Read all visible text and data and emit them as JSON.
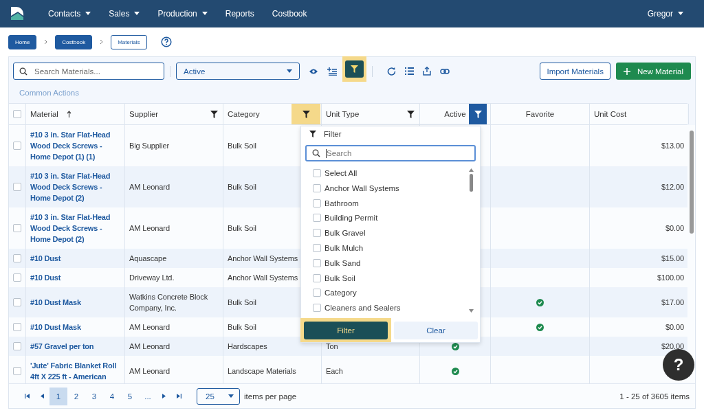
{
  "nav": {
    "items": [
      {
        "label": "Contacts",
        "has_menu": true
      },
      {
        "label": "Sales",
        "has_menu": true
      },
      {
        "label": "Production",
        "has_menu": true
      },
      {
        "label": "Reports",
        "has_menu": false
      },
      {
        "label": "Costbook",
        "has_menu": false
      }
    ],
    "user": {
      "label": "Gregor",
      "has_menu": true
    }
  },
  "breadcrumb": [
    {
      "label": "Home",
      "current": false
    },
    {
      "label": "Costbook",
      "current": false
    },
    {
      "label": "Materials",
      "current": true
    }
  ],
  "toolbar": {
    "search": {
      "placeholder": "Search Materials..."
    },
    "status_select": {
      "value": "Active"
    },
    "filter_toggle": {
      "selected": true,
      "highlighted": true
    },
    "import_button": "Import Materials",
    "new_button": "New Material"
  },
  "common_actions": "Common Actions",
  "table": {
    "all_selected": false,
    "columns": [
      {
        "label": "Material",
        "kind": "link",
        "sorted": true,
        "filterable": false,
        "filter_active": false,
        "highlighted": false
      },
      {
        "label": "Supplier",
        "kind": "text",
        "sorted": false,
        "filterable": true,
        "filter_active": false,
        "highlighted": false
      },
      {
        "label": "Category",
        "kind": "text",
        "sorted": false,
        "filterable": true,
        "filter_active": false,
        "highlighted": true
      },
      {
        "label": "Unit Type",
        "kind": "text",
        "sorted": false,
        "filterable": true,
        "filter_active": false,
        "highlighted": false
      },
      {
        "label": "Active",
        "kind": "check",
        "sorted": false,
        "filterable": true,
        "filter_active": true,
        "highlighted": false
      },
      {
        "label": "Favorite",
        "kind": "check",
        "sorted": false,
        "filterable": false,
        "filter_active": false,
        "highlighted": false
      },
      {
        "label": "Unit Cost",
        "kind": "money",
        "sorted": false,
        "filterable": false,
        "filter_active": false,
        "highlighted": false
      }
    ],
    "rows": [
      {
        "selected": false,
        "cells": [
          "#10 3 in. Star Flat-Head Wood Deck Screws - Home Depot (1) (1)",
          "Big Supplier",
          "Bulk Soil",
          null,
          null,
          false,
          "$13.00"
        ]
      },
      {
        "selected": false,
        "cells": [
          "#10 3 in. Star Flat-Head Wood Deck Screws - Home Depot (2)",
          "AM Leonard",
          "Bulk Soil",
          null,
          null,
          false,
          "$12.00"
        ]
      },
      {
        "selected": false,
        "cells": [
          "#10 3 in. Star Flat-Head Wood Deck Screws - Home Depot (2)",
          "AM Leonard",
          "Bulk Soil",
          null,
          null,
          false,
          "$0.00"
        ]
      },
      {
        "selected": false,
        "cells": [
          "#10 Dust",
          "Aquascape",
          "Anchor Wall Systems",
          null,
          null,
          false,
          "$15.00"
        ]
      },
      {
        "selected": false,
        "cells": [
          "#10 Dust",
          "Driveway Ltd.",
          "Anchor Wall Systems",
          null,
          null,
          false,
          "$100.00"
        ]
      },
      {
        "selected": false,
        "cells": [
          "#10 Dust Mask",
          "Watkins Concrete Block Company, Inc.",
          "Bulk Soil",
          null,
          null,
          true,
          "$17.00"
        ]
      },
      {
        "selected": false,
        "cells": [
          "#10 Dust Mask",
          "AM Leonard",
          "Bulk Soil",
          null,
          null,
          true,
          "$0.00"
        ]
      },
      {
        "selected": false,
        "cells": [
          "#57 Gravel per ton",
          "AM Leonard",
          "Hardscapes",
          "Ton",
          true,
          false,
          "$20.00"
        ]
      },
      {
        "selected": false,
        "cells": [
          "'Jute' Fabric Blanket Roll 4ft X 225 ft - American",
          "AM Leonard",
          "Landscape Materials",
          "Each",
          true,
          false,
          null
        ]
      }
    ]
  },
  "filter_popup": {
    "title": "Filter",
    "search": {
      "placeholder": "Search"
    },
    "options": [
      {
        "label": "Select All",
        "checked": false
      },
      {
        "label": "Anchor Wall Systems",
        "checked": false
      },
      {
        "label": "Bathroom",
        "checked": false
      },
      {
        "label": "Building Permit",
        "checked": false
      },
      {
        "label": "Bulk Gravel",
        "checked": false
      },
      {
        "label": "Bulk Mulch",
        "checked": false
      },
      {
        "label": "Bulk Sand",
        "checked": false
      },
      {
        "label": "Bulk Soil",
        "checked": false
      },
      {
        "label": "Category",
        "checked": false
      },
      {
        "label": "Cleaners and Sealers",
        "checked": false
      }
    ],
    "apply_button": {
      "label": "Filter",
      "highlighted": true
    },
    "clear_button": "Clear"
  },
  "pager": {
    "pages": [
      {
        "label": "1",
        "selected": true
      },
      {
        "label": "2",
        "selected": false
      },
      {
        "label": "3",
        "selected": false
      },
      {
        "label": "4",
        "selected": false
      },
      {
        "label": "5",
        "selected": false
      },
      {
        "label": "...",
        "selected": false
      }
    ],
    "page_size": "25",
    "page_size_label": "items per page",
    "summary": "1 - 25 of 3605 items"
  },
  "help_button": "?"
}
